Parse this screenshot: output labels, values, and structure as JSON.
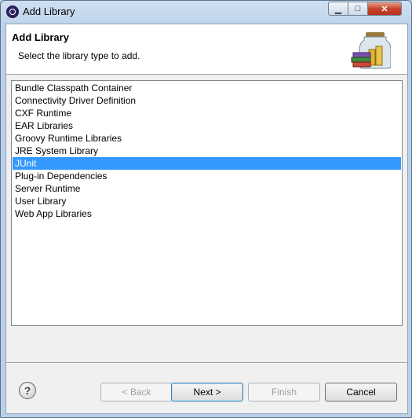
{
  "window": {
    "title": "Add Library",
    "minimize_glyph": "▁",
    "maximize_glyph": "□",
    "close_glyph": "✕"
  },
  "banner": {
    "title": "Add Library",
    "description": "Select the library type to add.",
    "image": "library-jar-icon"
  },
  "library_types": [
    "Bundle Classpath Container",
    "Connectivity Driver Definition",
    "CXF Runtime",
    "EAR Libraries",
    "Groovy Runtime Libraries",
    "JRE System Library",
    "JUnit",
    "Plug-in Dependencies",
    "Server Runtime",
    "User Library",
    "Web App Libraries"
  ],
  "selected_library": "JUnit",
  "buttons": {
    "help": "?",
    "back": "< Back",
    "next": "Next >",
    "finish": "Finish",
    "cancel": "Cancel"
  },
  "colors": {
    "selection": "#3399ff",
    "close_button": "#c7452e"
  }
}
